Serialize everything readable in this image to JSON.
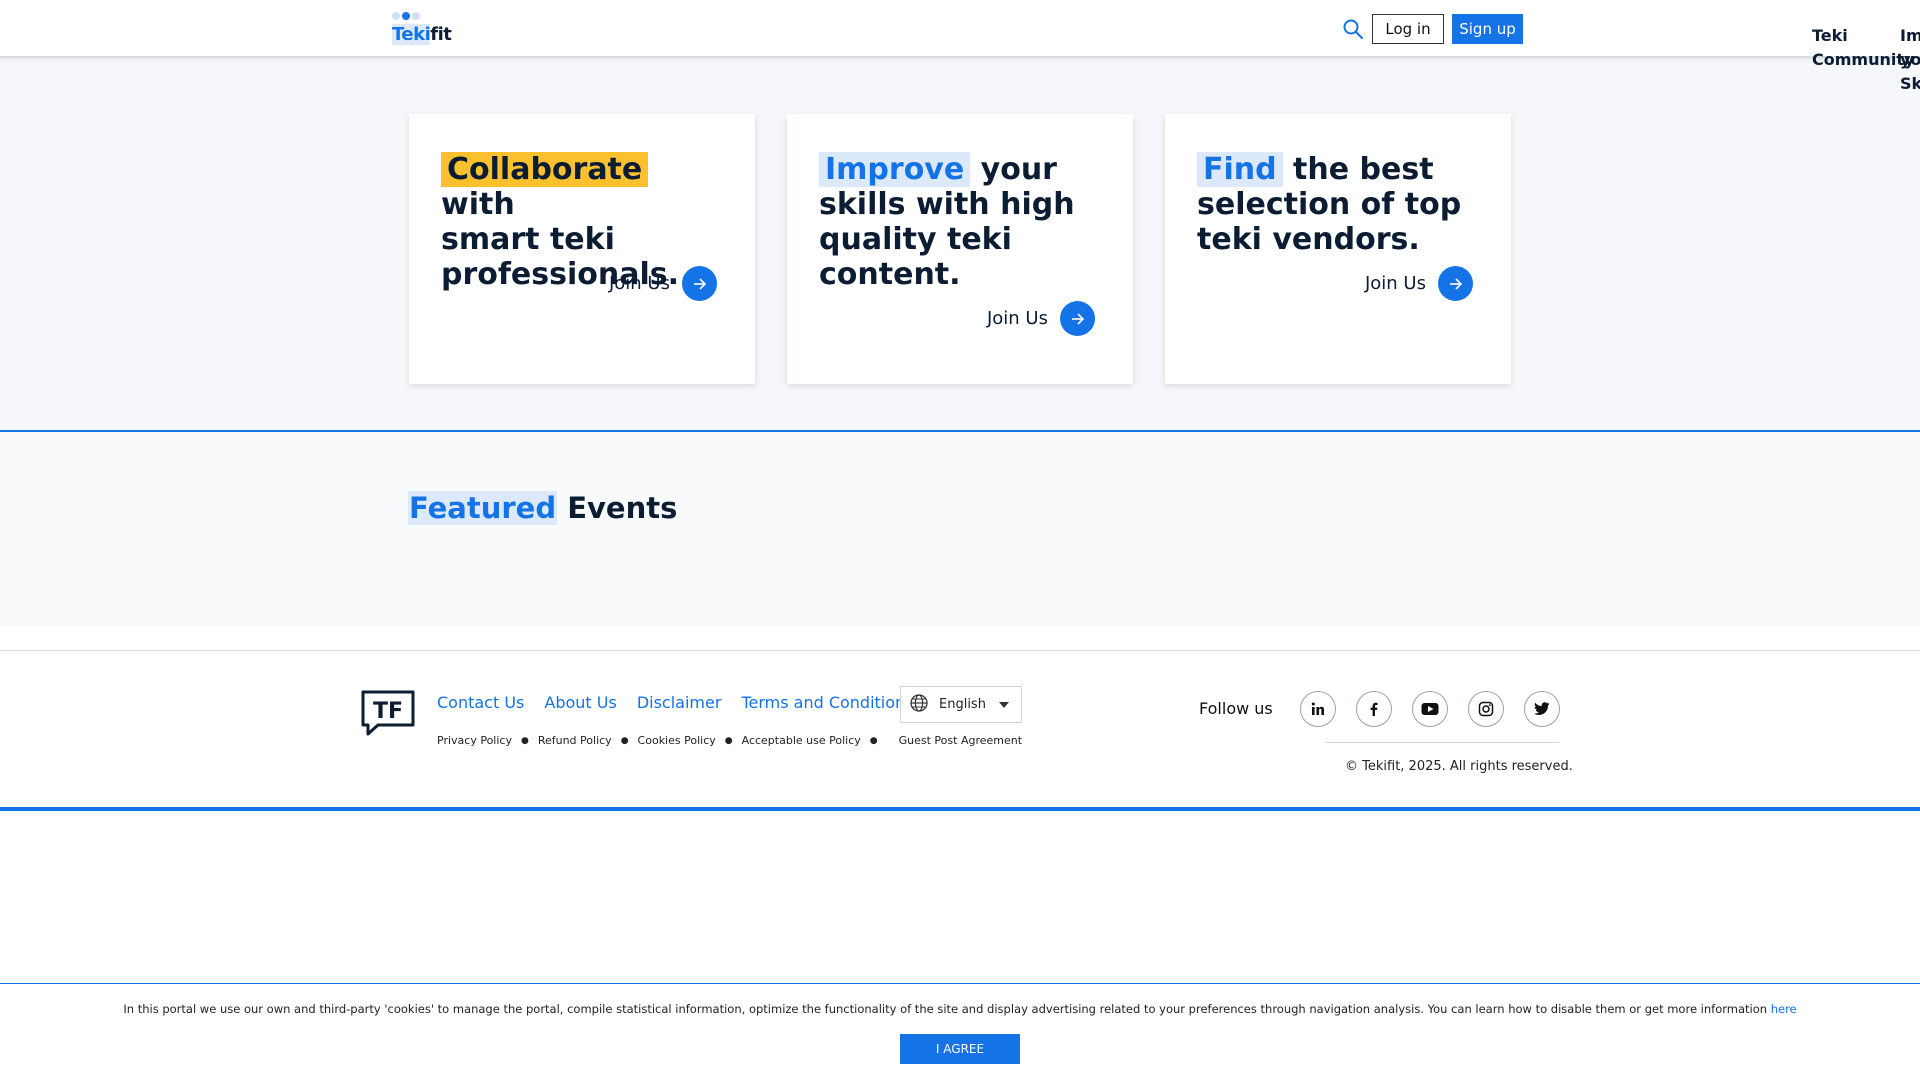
{
  "brand": {
    "logo_part1": "Teki",
    "logo_part2": "fit",
    "colors": {
      "primary": "#1473e6",
      "highlight_yellow": "#fbc02d",
      "highlight_blue": "#dbe9fb",
      "text": "#0b1c33"
    }
  },
  "header": {
    "search_icon": "search-icon",
    "login_label": "Log in",
    "signup_label": "Sign up",
    "overflow_nav": {
      "item1_line1": "Teki",
      "item1_line2": "Community",
      "item2_line1": "Im",
      "item2_line2": "yo",
      "item2_line3": "Sk"
    }
  },
  "cards": [
    {
      "highlight": "Collaborate",
      "rest_line1": " with",
      "rest": "smart teki professionals.",
      "join_label": "Join Us"
    },
    {
      "highlight": "Improve",
      "rest_line1": " your",
      "rest": "skills with high quality teki content.",
      "join_label": "Join Us"
    },
    {
      "highlight": "Find",
      "rest_line1": " the best",
      "rest": "selection of top teki vendors.",
      "join_label": "Join Us"
    }
  ],
  "featured": {
    "highlight": "Featured",
    "rest": " Events"
  },
  "footer": {
    "logo_text": "TF",
    "nav": [
      "Contact Us",
      "About Us",
      "Disclaimer",
      "Terms and Conditions"
    ],
    "language": "English",
    "policies": [
      "Privacy Policy",
      "Refund Policy",
      "Cookies Policy",
      "Acceptable use Policy",
      "Guest Post Agreement"
    ],
    "follow_label": "Follow us",
    "socials": [
      "linkedin-icon",
      "facebook-icon",
      "youtube-icon",
      "instagram-icon",
      "twitter-icon"
    ],
    "copyright": "© Tekifit, 2025. All rights reserved."
  },
  "cookie": {
    "message": "In this portal we use our own and third-party 'cookies' to manage the portal, compile statistical information, optimize the functionality of the site and display advertising related to your preferences through navigation analysis. You can learn how to disable them or get more information ",
    "link_label": "here",
    "agree_label": "I AGREE"
  }
}
